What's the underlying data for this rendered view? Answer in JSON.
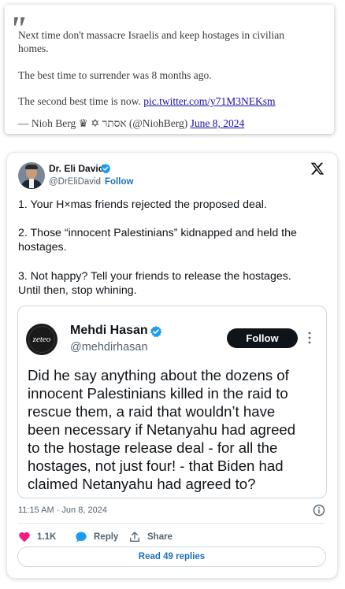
{
  "quote": {
    "lines": [
      "Next time don't massacre Israelis and keep hostages in civilian",
      "homes.",
      "The best time to surrender was 8 months ago.",
      "The second best time is now."
    ],
    "link_text": "pic.twitter.com/y71M3NEKsm",
    "attribution_prefix": "— Nioh Berg ♛ ✡ אסתר (@NiohBerg)",
    "date_link": "June 8, 2024"
  },
  "tweet": {
    "author_name": "Dr. Eli David",
    "author_handle": "@DrEliDavid",
    "separator": "·",
    "follow_label": "Follow",
    "lines": [
      "1. Your H×mas friends rejected the proposed deal.",
      "2. Those “innocent Palestinians” kidnapped and held the",
      "hostages.",
      "3. Not happy? Tell your friends to release the hostages.",
      "Until then, stop whining."
    ],
    "quoted": {
      "avatar_text": "zeteo",
      "name": "Mehdi Hasan",
      "handle": "@mehdirhasan",
      "follow_label": "Follow",
      "lines": [
        "Did he say anything about the dozens of",
        "innocent Palestinians killed in the raid to",
        "rescue them, a raid that wouldn’t have",
        "been necessary if Netanyahu had agreed",
        "to the hostage release deal - for all the",
        "hostages, not just four! - that Biden had",
        "claimed Netanyahu had agreed to?"
      ]
    },
    "timestamp": "11:15 AM · Jun 8, 2024",
    "likes": "1.1K",
    "reply_label": "Reply",
    "share_label": "Share",
    "read_replies": "Read 49 replies"
  },
  "icons": {
    "quote_mark": "quotation-mark",
    "verified": "verified-badge-icon",
    "x_logo": "x-logo-icon",
    "like": "heart-icon",
    "reply": "speech-bubble-icon",
    "share": "share-upload-icon",
    "info": "info-icon",
    "more": "more-vertical-icon"
  },
  "colors": {
    "link": "#1a0dab",
    "x_blue": "#1d70b8",
    "verified": "#1d9bf0",
    "like": "#f91880",
    "reply": "#1d9bf0",
    "text": "#0f1419",
    "muted": "#536471"
  }
}
